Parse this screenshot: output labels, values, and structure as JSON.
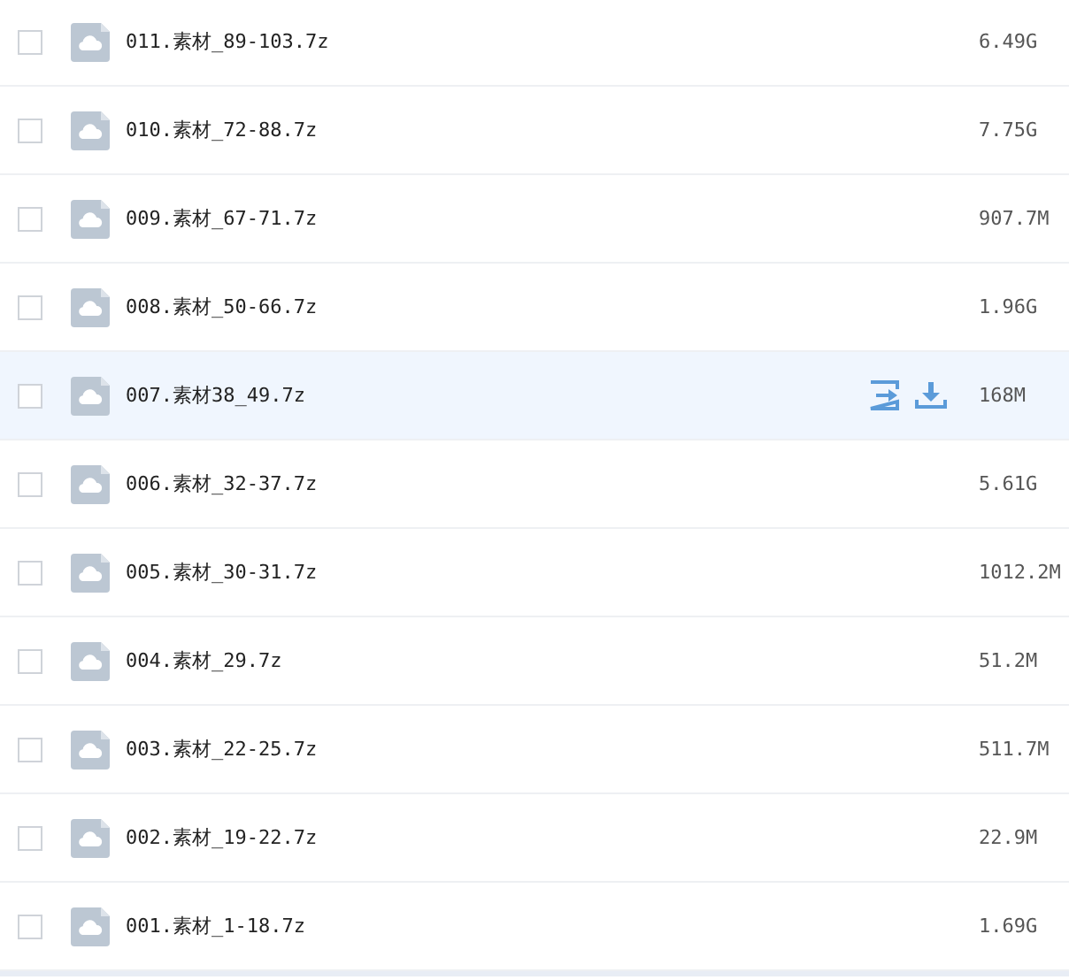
{
  "files": [
    {
      "name": "011.素材_89-103.7z",
      "size": "6.49G",
      "checked": false,
      "hovered": false
    },
    {
      "name": "010.素材_72-88.7z",
      "size": "7.75G",
      "checked": false,
      "hovered": false
    },
    {
      "name": "009.素材_67-71.7z",
      "size": "907.7M",
      "checked": false,
      "hovered": false
    },
    {
      "name": "008.素材_50-66.7z",
      "size": "1.96G",
      "checked": false,
      "hovered": false
    },
    {
      "name": "007.素材38_49.7z",
      "size": "168M",
      "checked": false,
      "hovered": true
    },
    {
      "name": "006.素材_32-37.7z",
      "size": "5.61G",
      "checked": false,
      "hovered": false
    },
    {
      "name": "005.素材_30-31.7z",
      "size": "1012.2M",
      "checked": false,
      "hovered": false
    },
    {
      "name": "004.素材_29.7z",
      "size": "51.2M",
      "checked": false,
      "hovered": false
    },
    {
      "name": "003.素材_22-25.7z",
      "size": "511.7M",
      "checked": false,
      "hovered": false
    },
    {
      "name": "002.素材_19-22.7z",
      "size": "22.9M",
      "checked": false,
      "hovered": false
    },
    {
      "name": "001.素材_1-18.7z",
      "size": "1.69G",
      "checked": false,
      "hovered": false
    }
  ]
}
